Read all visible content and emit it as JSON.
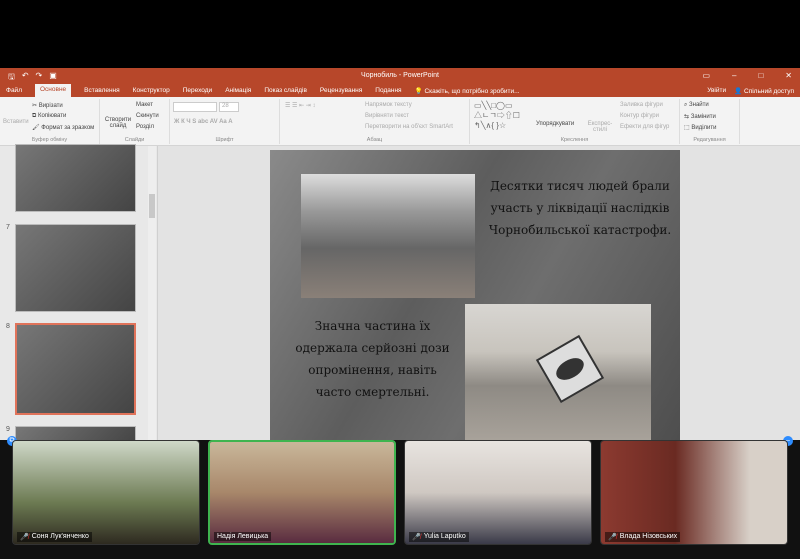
{
  "window": {
    "title": "Чорнобиль - PowerPoint"
  },
  "tabs": [
    {
      "label": "Файл"
    },
    {
      "label": "Основне",
      "active": true
    },
    {
      "label": "Вставлення"
    },
    {
      "label": "Конструктор"
    },
    {
      "label": "Переходи"
    },
    {
      "label": "Анімація"
    },
    {
      "label": "Показ слайдів"
    },
    {
      "label": "Рецензування"
    },
    {
      "label": "Подання"
    },
    {
      "label": "Скажіть, що потрібно зробити..."
    }
  ],
  "account": {
    "signin": "Увійти",
    "share": "Спільний доступ"
  },
  "ribbon": {
    "clipboard": {
      "paste": "Вставити",
      "cut": "Вирізати",
      "copy": "Копіювати",
      "format_painter": "Формат за зразком",
      "label": "Буфер обміну"
    },
    "slides": {
      "new_slide": "Створити слайд",
      "layout": "Макет",
      "reset": "Скинути",
      "section": "Розділ",
      "label": "Слайди"
    },
    "font": {
      "size": "28",
      "label": "Шрифт"
    },
    "paragraph": {
      "text_direction": "Напрямок тексту",
      "align_text": "Вирівняти текст",
      "smartart": "Перетворити на об'єкт SmartArt",
      "label": "Абзац"
    },
    "drawing": {
      "arrange": "Упорядкувати",
      "quick_styles": "Експрес-стилі",
      "shape_fill": "Заливка фігури",
      "shape_outline": "Контур фігури",
      "shape_effects": "Ефекти для фігур",
      "label": "Креслення"
    },
    "editing": {
      "find": "Знайти",
      "replace": "Замінити",
      "select": "Виділити",
      "label": "Редагування"
    }
  },
  "thumbnails": [
    {
      "number": "7"
    },
    {
      "number": "8",
      "selected": true
    },
    {
      "number": "9"
    }
  ],
  "slide": {
    "text1": "Десятки тисяч людей брали участь у ліквідації наслідків Чорнобильської катастрофи.",
    "text2": "Значна частина їх одержала серйозні дози опромінення, навіть часто смертельні."
  },
  "participants": [
    {
      "name": "Соня Лук'янченко",
      "muted": true,
      "bg": "#6c7a52"
    },
    {
      "name": "Надія  Левицька",
      "muted": false,
      "active": true,
      "bg": "#a8876a"
    },
    {
      "name": "Yulia Laputko",
      "muted": true,
      "bg": "#cfc8c2"
    },
    {
      "name": "Влада Нізовських",
      "muted": true,
      "bg": "#8c3a30"
    }
  ]
}
